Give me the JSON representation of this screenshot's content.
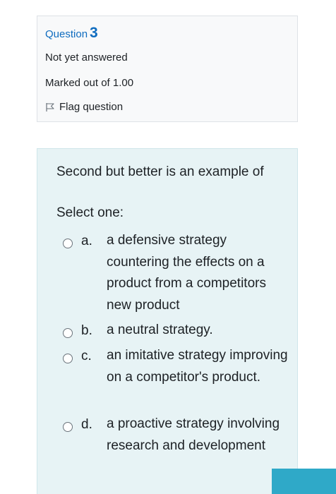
{
  "question_info": {
    "label": "Question",
    "number": "3",
    "state": "Not yet answered",
    "grade": "Marked out of 1.00",
    "flag_label": "Flag question"
  },
  "question": {
    "text": "Second but better is an example of",
    "prompt": "Select one:",
    "options": [
      {
        "letter": "a.",
        "text": "a defensive strategy countering the effects on a product from a competitors new product",
        "selected": false
      },
      {
        "letter": "b.",
        "text": "a neutral strategy.",
        "selected": false
      },
      {
        "letter": "c.",
        "text": "an imitative strategy improving on a competitor's product.",
        "selected": false
      },
      {
        "letter": "d.",
        "text": "a proactive strategy involving research and development",
        "selected": false
      }
    ]
  },
  "colors": {
    "accent": "#0f6cbf",
    "content_bg": "#e7f3f5",
    "info_bg": "#f8f9fa",
    "button": "#2fa9c8"
  }
}
